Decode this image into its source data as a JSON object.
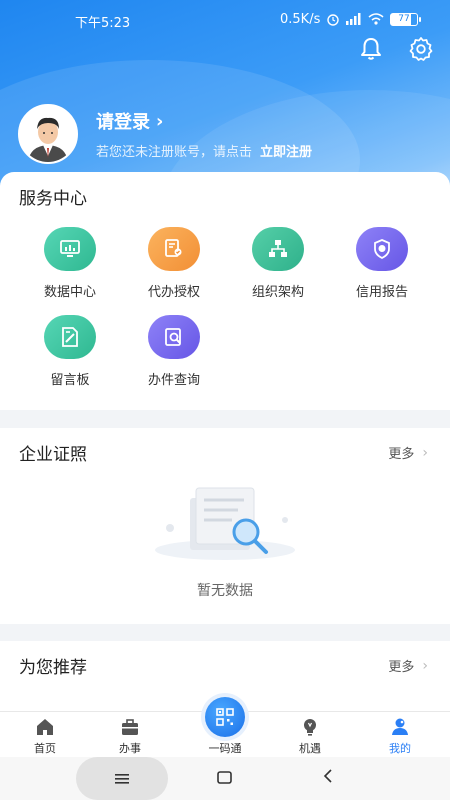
{
  "status_bar": {
    "time": "下午5:23",
    "speed": "0.5K/s",
    "battery": "77"
  },
  "header": {
    "login_label": "请登录",
    "register_hint": "若您还未注册账号，请点击",
    "register_link": "立即注册"
  },
  "service_center": {
    "title": "服务中心",
    "items": [
      {
        "label": "数据中心",
        "icon": "data-center-icon",
        "color": "#3cc4a4"
      },
      {
        "label": "代办授权",
        "icon": "authorization-icon",
        "color": "#f7a04b"
      },
      {
        "label": "组织架构",
        "icon": "org-chart-icon",
        "color": "#40bf9a"
      },
      {
        "label": "信用报告",
        "icon": "credit-report-icon",
        "color": "#7a6cf0"
      },
      {
        "label": "留言板",
        "icon": "message-board-icon",
        "color": "#3cc4a4"
      },
      {
        "label": "办件查询",
        "icon": "case-query-icon",
        "color": "#7a6cf0"
      }
    ]
  },
  "enterprise_license": {
    "title": "企业证照",
    "more": "更多",
    "empty_text": "暂无数据"
  },
  "recommend": {
    "title": "为您推荐",
    "more": "更多"
  },
  "tab_bar": {
    "tabs": [
      {
        "label": "首页",
        "icon": "home-icon"
      },
      {
        "label": "办事",
        "icon": "briefcase-icon"
      },
      {
        "label": "一码通",
        "icon": "qr-code-icon"
      },
      {
        "label": "机遇",
        "icon": "lightbulb-icon"
      },
      {
        "label": "我的",
        "icon": "profile-icon"
      }
    ],
    "active_index": 4
  },
  "colors": {
    "brand": "#2b7ff5",
    "header_gradient_start": "#1f86f0"
  }
}
